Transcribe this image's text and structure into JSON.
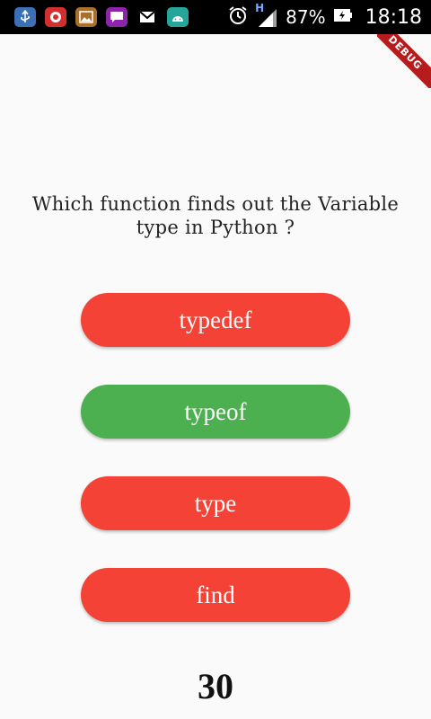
{
  "status_bar": {
    "notification_icons": [
      {
        "name": "usb-icon",
        "color": "#3b6fb6"
      },
      {
        "name": "recorder-icon",
        "color": "#d32f2f"
      },
      {
        "name": "gallery-icon",
        "color": "#a8702a"
      },
      {
        "name": "chat-icon",
        "color": "#8e24aa"
      },
      {
        "name": "gmail-icon",
        "color": "#000000"
      },
      {
        "name": "android-icon",
        "color": "#26a69a"
      }
    ],
    "network_label": "H",
    "battery_percent": "87%",
    "time": "18:18"
  },
  "debug_banner": {
    "label": "DEBUG"
  },
  "quiz": {
    "question": "Which function finds out the Variable type in Python ?",
    "answers": [
      {
        "label": "typedef",
        "color": "#f44336"
      },
      {
        "label": "typeof",
        "color": "#4caf50"
      },
      {
        "label": "type",
        "color": "#f44336"
      },
      {
        "label": "find",
        "color": "#f44336"
      }
    ],
    "score": "30"
  }
}
